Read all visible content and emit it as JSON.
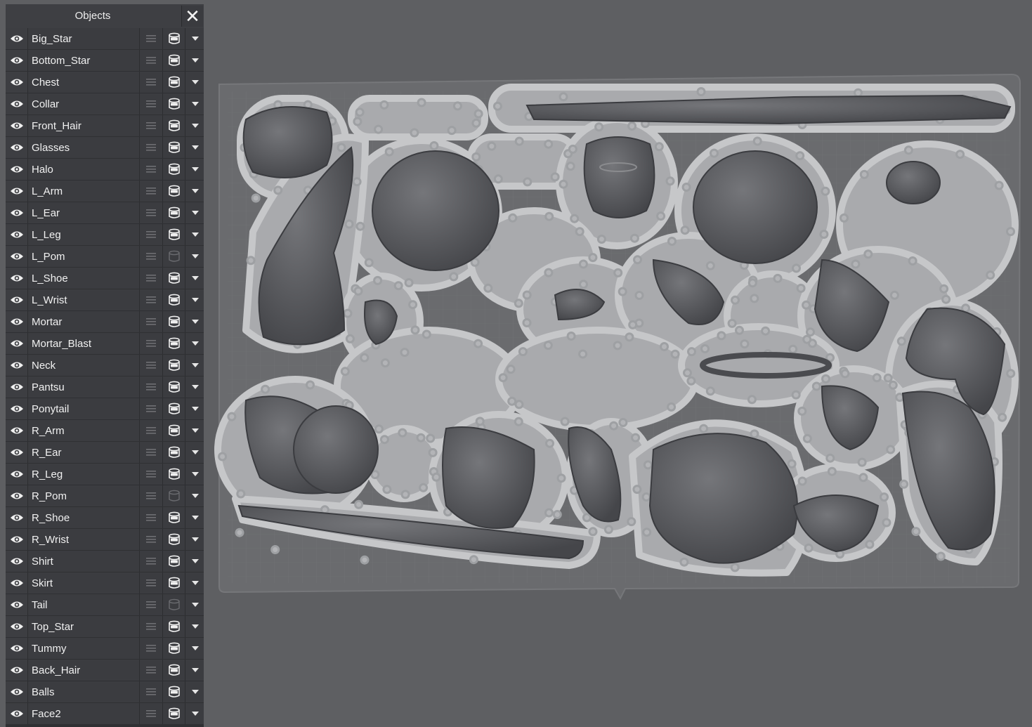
{
  "panel": {
    "title": "Objects",
    "close_glyph": "✕",
    "items": [
      {
        "label": "Big_Star",
        "material_on": true
      },
      {
        "label": "Bottom_Star",
        "material_on": true
      },
      {
        "label": "Chest",
        "material_on": true
      },
      {
        "label": "Collar",
        "material_on": true
      },
      {
        "label": "Front_Hair",
        "material_on": true
      },
      {
        "label": "Glasses",
        "material_on": true
      },
      {
        "label": "Halo",
        "material_on": true
      },
      {
        "label": "L_Arm",
        "material_on": true
      },
      {
        "label": "L_Ear",
        "material_on": true
      },
      {
        "label": "L_Leg",
        "material_on": true
      },
      {
        "label": "L_Pom",
        "material_on": false
      },
      {
        "label": "L_Shoe",
        "material_on": true
      },
      {
        "label": "L_Wrist",
        "material_on": true
      },
      {
        "label": "Mortar",
        "material_on": true
      },
      {
        "label": "Mortar_Blast",
        "material_on": true
      },
      {
        "label": "Neck",
        "material_on": true
      },
      {
        "label": "Pantsu",
        "material_on": true
      },
      {
        "label": "Ponytail",
        "material_on": true
      },
      {
        "label": "R_Arm",
        "material_on": true
      },
      {
        "label": "R_Ear",
        "material_on": true
      },
      {
        "label": "R_Leg",
        "material_on": true
      },
      {
        "label": "R_Pom",
        "material_on": false
      },
      {
        "label": "R_Shoe",
        "material_on": true
      },
      {
        "label": "R_Wrist",
        "material_on": true
      },
      {
        "label": "Shirt",
        "material_on": true
      },
      {
        "label": "Skirt",
        "material_on": true
      },
      {
        "label": "Tail",
        "material_on": false
      },
      {
        "label": "Top_Star",
        "material_on": true
      },
      {
        "label": "Tummy",
        "material_on": true
      },
      {
        "label": "Back_Hair",
        "material_on": true
      },
      {
        "label": "Balls",
        "material_on": true
      },
      {
        "label": "Face2",
        "material_on": true
      }
    ]
  },
  "icons": {
    "visibility": "eye-icon",
    "drag": "drag-handle-icon",
    "material": "resin-container-icon",
    "dropdown": "chevron-down-icon",
    "close": "close-icon"
  },
  "colors": {
    "viewport_bg": "#5e5f62",
    "panel_bg": "#2f3033",
    "row_bg": "#3b3c40",
    "plate": "#6a6b6e",
    "supports": "#c2c3c5",
    "model": "#57585b"
  }
}
